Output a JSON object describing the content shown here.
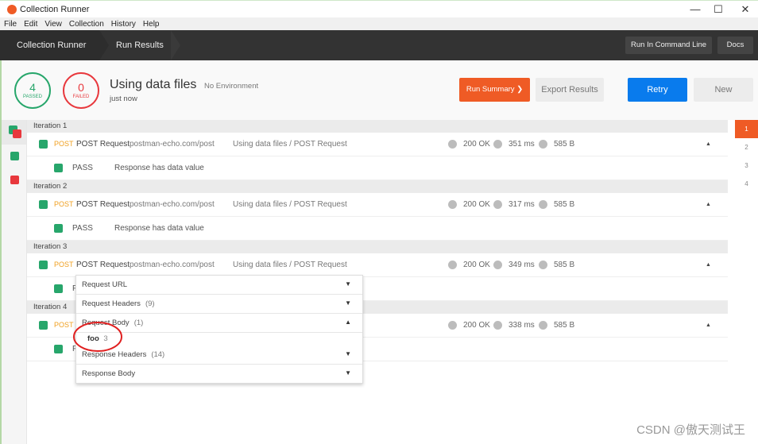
{
  "window": {
    "title": "Collection Runner",
    "minimize": "—",
    "maximize": "☐",
    "close": "✕"
  },
  "menu": [
    "File",
    "Edit",
    "View",
    "Collection",
    "History",
    "Help"
  ],
  "nav": {
    "crumbs": [
      "Collection Runner",
      "Run Results"
    ],
    "run_cli": "Run In Command Line",
    "docs": "Docs"
  },
  "summary": {
    "passed": "4",
    "passed_label": "PASSED",
    "failed": "0",
    "failed_label": "FAILED",
    "collection": "Using data files",
    "environment": "No Environment",
    "time": "just now"
  },
  "actions": {
    "run_summary": "Run Summary",
    "export": "Export Results",
    "retry": "Retry",
    "new": "New"
  },
  "colors": {
    "accent": "#ef5b25",
    "pass": "#27a66b",
    "fail": "#e8383d",
    "retry": "#097bed"
  },
  "iterations": [
    {
      "label": "Iteration 1",
      "method": "POST",
      "name": "POST Request",
      "url": "postman-echo.com/post",
      "path": "Using data files / POST Request",
      "status": "200 OK",
      "time": "351 ms",
      "size": "585 B",
      "test_result": "PASS",
      "test_name": "Response has data value"
    },
    {
      "label": "Iteration 2",
      "method": "POST",
      "name": "POST Request",
      "url": "postman-echo.com/post",
      "path": "Using data files / POST Request",
      "status": "200 OK",
      "time": "317 ms",
      "size": "585 B",
      "test_result": "PASS",
      "test_name": "Response has data value"
    },
    {
      "label": "Iteration 3",
      "method": "POST",
      "name": "POST Request",
      "url": "postman-echo.com/post",
      "path": "Using data files / POST Request",
      "status": "200 OK",
      "time": "349 ms",
      "size": "585 B",
      "test_result": "P",
      "test_name": ""
    },
    {
      "label": "Iteration 4",
      "method": "POST",
      "name": "",
      "url": "",
      "path": "",
      "status": "200 OK",
      "time": "338 ms",
      "size": "585 B",
      "test_result": "P",
      "test_name": ""
    }
  ],
  "pager": [
    "1",
    "2",
    "3",
    "4"
  ],
  "popup": {
    "request_url": "Request URL",
    "request_headers": "Request Headers",
    "request_headers_count": "(9)",
    "request_body": "Request Body",
    "request_body_count": "(1)",
    "body_key": "foo",
    "body_value": "3",
    "response_headers": "Response Headers",
    "response_headers_count": "(14)",
    "response_body": "Response Body"
  },
  "watermark": "CSDN @傲天测试王"
}
